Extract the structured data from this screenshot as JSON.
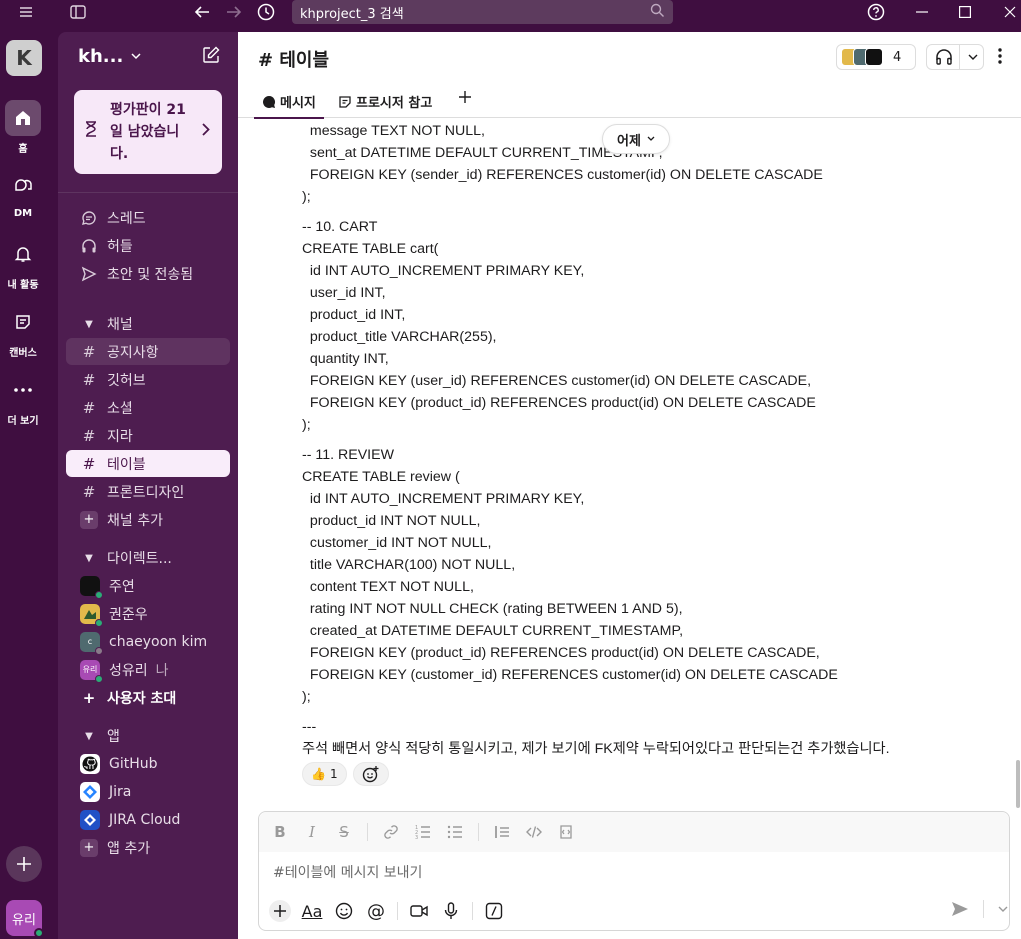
{
  "window": {
    "search_placeholder": "khproject_3 검색"
  },
  "rail": {
    "workspace_initial": "K",
    "items": [
      {
        "label": "홈"
      },
      {
        "label": "DM"
      },
      {
        "label": "내 활동"
      },
      {
        "label": "캔버스"
      },
      {
        "label": "더 보기"
      }
    ],
    "user_avatar": "유리"
  },
  "sidebar": {
    "workspace_name": "kh...",
    "trial_banner": "평가판이 21일 남았습니다.",
    "nav": [
      {
        "label": "스레드"
      },
      {
        "label": "허들"
      },
      {
        "label": "초안 및 전송됨"
      }
    ],
    "channels_header": "채널",
    "channels": [
      "공지사항",
      "깃허브",
      "소셜",
      "지라",
      "테이블",
      "프론트디자인"
    ],
    "add_channel": "채널 추가",
    "dm_header": "다이렉트...",
    "dms": [
      {
        "name": "주연",
        "color": "#111111"
      },
      {
        "name": "권준우",
        "color": "#e2b94b"
      },
      {
        "name": "chaeyoon kim",
        "color": "#4f6a6f"
      },
      {
        "name": "성유리",
        "suffix": "나",
        "color": "#a84ab4"
      }
    ],
    "invite": "사용자 초대",
    "apps_header": "앱",
    "apps": [
      {
        "name": "GitHub"
      },
      {
        "name": "Jira"
      },
      {
        "name": "JIRA Cloud"
      }
    ],
    "add_app": "앱 추가"
  },
  "header": {
    "channel_title": "# 테이블",
    "member_count": "4",
    "tabs": [
      {
        "label": "메시지"
      },
      {
        "label": "프로시저 참고"
      }
    ]
  },
  "message": {
    "date_divider": "어제",
    "lines": [
      "  message TEXT NOT NULL,",
      "  sent_at DATETIME DEFAULT CURRENT_TIMESTAMP,",
      "  FOREIGN KEY (sender_id) REFERENCES customer(id) ON DELETE CASCADE",
      ");",
      "",
      "-- 10. CART",
      "CREATE TABLE cart(",
      "  id INT AUTO_INCREMENT PRIMARY KEY,",
      "  user_id INT,",
      "  product_id INT,",
      "  product_title VARCHAR(255),",
      "  quantity INT,",
      "  FOREIGN KEY (user_id) REFERENCES customer(id) ON DELETE CASCADE,",
      "  FOREIGN KEY (product_id) REFERENCES product(id) ON DELETE CASCADE",
      ");",
      "",
      "-- 11. REVIEW",
      "CREATE TABLE review (",
      "  id INT AUTO_INCREMENT PRIMARY KEY,",
      "  product_id INT NOT NULL,",
      "  customer_id INT NOT NULL,",
      "  title VARCHAR(100) NOT NULL,",
      "  content TEXT NOT NULL,",
      "  rating INT NOT NULL CHECK (rating BETWEEN 1 AND 5),",
      "  created_at DATETIME DEFAULT CURRENT_TIMESTAMP,",
      "  FOREIGN KEY (product_id) REFERENCES product(id) ON DELETE CASCADE,",
      "  FOREIGN KEY (customer_id) REFERENCES customer(id) ON DELETE CASCADE",
      ");",
      "",
      "---",
      "주석 빼면서 양식 적당히 통일시키고, 제가 보기에 FK제약 누락되어있다고 판단되는건 추가했습니다."
    ],
    "reaction_emoji": "👍",
    "reaction_count": "1"
  },
  "composer": {
    "placeholder": "#테이블에 메시지 보내기"
  },
  "colors": {
    "aubergine": "#3f0e40",
    "sidebar": "#4e1d50",
    "selected_channel": "#f9edfa",
    "online": "#2bac76"
  }
}
